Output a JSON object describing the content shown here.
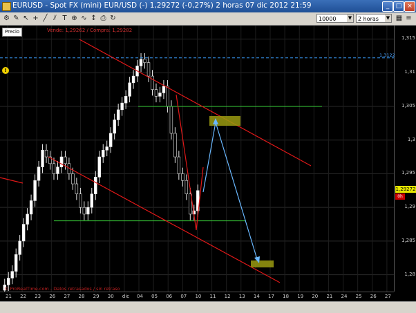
{
  "window": {
    "title": "EURUSD - Spot FX (mini) EUR/USD (-)  1,29272 (-0,27%)   2 horas  07 dic 2012 21:59",
    "buttons": {
      "minimize": "_",
      "maximize": "□",
      "close": "×"
    }
  },
  "toolbar": {
    "volume_dropdown": "10000 unidad...",
    "interval_dropdown": "2 horas",
    "icons": [
      "settings-icon",
      "draw-icon",
      "cursor-icon",
      "crosshair-icon",
      "line-icon",
      "channel-icon",
      "text-icon",
      "zoom-icon",
      "indicator-icon",
      "scale-icon",
      "print-icon",
      "refresh-icon"
    ]
  },
  "chart": {
    "tag": "Precio",
    "bid_ask": "Vende: 1,29262 / Compra: 1,29282",
    "watermark": "© ProRealTime.com - Datos retrasados / sin retraso",
    "current_price": "1,29272",
    "current_sub": "0h",
    "dashed_level_label": "1,3122",
    "alert_icon": "!"
  },
  "chart_data": {
    "type": "candlestick",
    "symbol": "EURUSD",
    "interval": "2 horas",
    "last": 1.29272,
    "change_pct": -0.27,
    "ylim": [
      1.2775,
      1.317
    ],
    "y_ticks": [
      "1,315",
      "1,31",
      "1,305",
      "1,3",
      "1,295",
      "1,29",
      "1,285",
      "1,28"
    ],
    "y_values": [
      1.315,
      1.31,
      1.305,
      1.3,
      1.295,
      1.29,
      1.285,
      1.28
    ],
    "x_labels": [
      "21",
      "22",
      "23",
      "26",
      "27",
      "28",
      "29",
      "30",
      "dic",
      "04",
      "05",
      "06",
      "07",
      "10",
      "11",
      "12",
      "13",
      "14",
      "17",
      "18",
      "19",
      "20",
      "21",
      "24",
      "25",
      "26",
      "27"
    ],
    "series_close": [
      1.2785,
      1.2795,
      1.2805,
      1.283,
      1.285,
      1.2875,
      1.289,
      1.291,
      1.294,
      1.296,
      1.2985,
      1.2975,
      1.2965,
      1.295,
      1.296,
      1.2975,
      1.2965,
      1.295,
      1.2935,
      1.292,
      1.29,
      1.289,
      1.29,
      1.292,
      1.2945,
      1.2975,
      1.2985,
      1.299,
      1.301,
      1.303,
      1.3045,
      1.3055,
      1.3065,
      1.3085,
      1.3095,
      1.311,
      1.312,
      1.3115,
      1.3095,
      1.3075,
      1.3065,
      1.307,
      1.308,
      1.305,
      1.301,
      1.2975,
      1.295,
      1.294,
      1.292,
      1.289,
      1.2895,
      1.2925
    ],
    "levels": {
      "dashed_resistance": 1.3122,
      "upper_support": 1.305,
      "lower_support": 1.288
    }
  }
}
